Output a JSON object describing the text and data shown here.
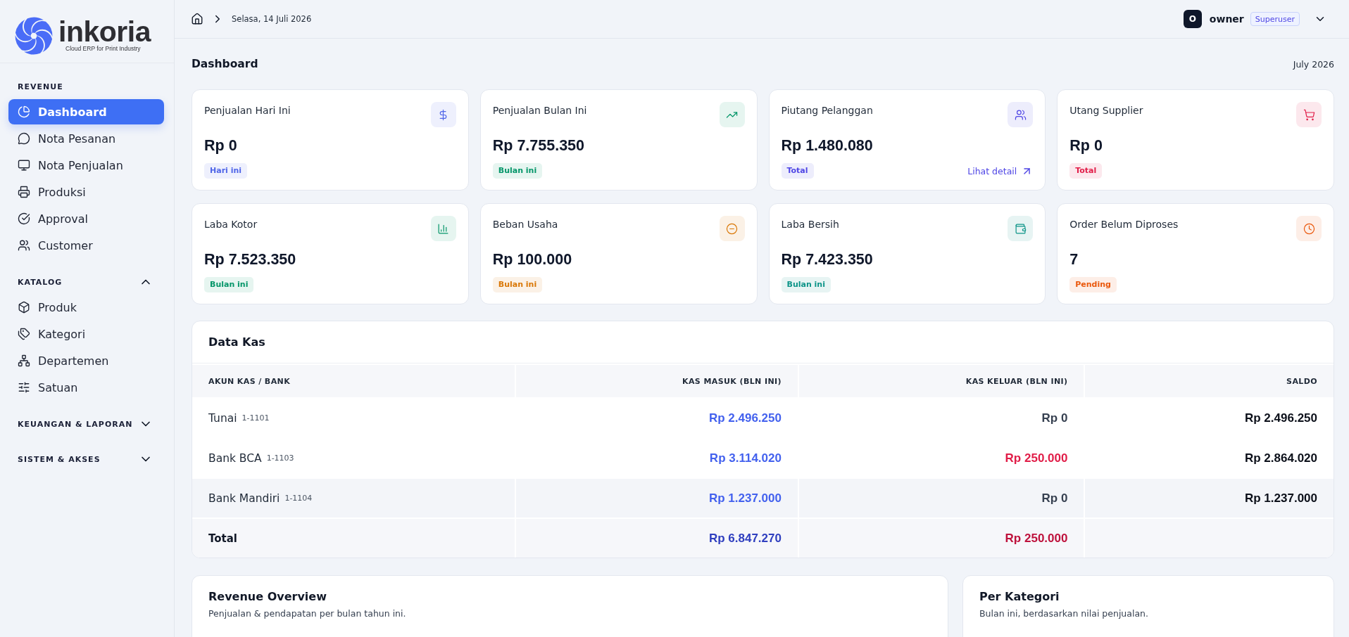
{
  "brand": {
    "name": "inkoria",
    "tagline": "Cloud ERP for Print Industry"
  },
  "sidebar": {
    "sections": [
      {
        "title": "REVENUE",
        "kind": "fixed",
        "expanded": true,
        "items": [
          {
            "label": "Dashboard",
            "selected": true
          },
          {
            "label": "Nota Pesanan",
            "selected": false
          },
          {
            "label": "Nota Penjualan",
            "selected": false
          },
          {
            "label": "Produksi",
            "selected": false
          },
          {
            "label": "Approval",
            "selected": false
          },
          {
            "label": "Customer",
            "selected": false
          }
        ]
      },
      {
        "title": "KATALOG",
        "kind": "collapsible",
        "expanded": true,
        "items": [
          {
            "label": "Produk",
            "selected": false
          },
          {
            "label": "Kategori",
            "selected": false
          },
          {
            "label": "Departemen",
            "selected": false
          },
          {
            "label": "Satuan",
            "selected": false
          }
        ]
      },
      {
        "title": "KEUANGAN & LAPORAN",
        "kind": "collapsible",
        "expanded": false
      },
      {
        "title": "SISTEM & AKSES",
        "kind": "collapsible",
        "expanded": false
      }
    ]
  },
  "top_bar": {
    "date": "Selasa, 14 Juli 2026",
    "user": {
      "initial": "O",
      "name": "owner",
      "role": "Superuser"
    }
  },
  "page": {
    "title": "Dashboard",
    "period": "July 2026"
  },
  "stats": [
    {
      "title": "Penjualan Hari Ini",
      "value": "Rp 0",
      "tag": "Hari ini",
      "color": "#5066e8"
    },
    {
      "title": "Penjualan Bulan Ini",
      "value": "Rp 7.755.350",
      "tag": "Bulan ini",
      "color": "#059669"
    },
    {
      "title": "Piutang Pelanggan",
      "value": "Rp 1.480.080",
      "tag": "Total",
      "color": "#4f46e5",
      "link": "Lihat detail"
    },
    {
      "title": "Utang Supplier",
      "value": "Rp 0",
      "tag": "Total",
      "color": "#e11d48"
    },
    {
      "title": "Laba Kotor",
      "value": "Rp 7.523.350",
      "tag": "Bulan ini",
      "color": "#059669"
    },
    {
      "title": "Beban Usaha",
      "value": "Rp 100.000",
      "tag": "Bulan ini",
      "color": "#d97706"
    },
    {
      "title": "Laba Bersih",
      "value": "Rp 7.423.350",
      "tag": "Bulan ini",
      "color": "#0d9488"
    },
    {
      "title": "Order Belum Diproses",
      "value": "7",
      "tag": "Pending",
      "color": "#ea580c"
    }
  ],
  "data_kas": {
    "title": "Data Kas",
    "columns": [
      "AKUN KAS / BANK",
      "KAS MASUK (BLN INI)",
      "KAS KELUAR (BLN INI)",
      "SALDO"
    ],
    "rows": [
      {
        "account": "Tunai",
        "code": "1-1101",
        "masuk": {
          "text": "Rp 2.496.250",
          "color": "#4361ee"
        },
        "keluar": {
          "text": "Rp 0",
          "color": "#374151"
        },
        "saldo": "Rp 2.496.250",
        "hovered": false
      },
      {
        "account": "Bank BCA",
        "code": "1-1103",
        "masuk": {
          "text": "Rp 3.114.020",
          "color": "#4361ee"
        },
        "keluar": {
          "text": "Rp 250.000",
          "color": "#e11d48"
        },
        "saldo": "Rp 2.864.020",
        "hovered": false
      },
      {
        "account": "Bank Mandiri",
        "code": "1-1104",
        "masuk": {
          "text": "Rp 1.237.000",
          "color": "#4361ee"
        },
        "keluar": {
          "text": "Rp 0",
          "color": "#374151"
        },
        "saldo": "Rp 1.237.000",
        "hovered": true
      }
    ],
    "total": {
      "label": "Total",
      "masuk": {
        "text": "Rp 6.847.270",
        "color": "#2f3fbf"
      },
      "keluar": {
        "text": "Rp 250.000",
        "color": "#be123c"
      }
    }
  },
  "panels": [
    {
      "title": "Revenue Overview",
      "subtitle": "Penjualan & pendapatan per bulan tahun ini."
    },
    {
      "title": "Per Kategori",
      "subtitle": "Bulan ini, berdasarkan nilai penjualan."
    }
  ]
}
